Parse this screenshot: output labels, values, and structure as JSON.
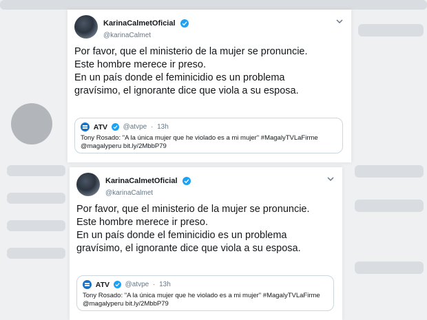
{
  "tweets": [
    {
      "display_name": "KarinaCalmetOficial",
      "handle": "@karinaCalmet",
      "text_lines": [
        "Por favor, que el ministerio de la mujer se pronuncie.",
        "Este hombre merece ir preso.",
        "En un país donde el feminicidio es un problema",
        "gravísimo, el ignorante dice que viola a su esposa."
      ],
      "quote": {
        "name": "ATV",
        "handle": "@atvpe",
        "separator": "·",
        "time": "13h",
        "text_line1": "Tony Rosado: \"A la única mujer que he violado es a mi mujer\" #MagalyTVLaFirme",
        "text_line2": "@magalyperu  bit.ly/2MbbP79"
      }
    },
    {
      "display_name": "KarinaCalmetOficial",
      "handle": "@karinaCalmet",
      "text_lines": [
        "Por favor, que el ministerio de la mujer se pronuncie.",
        "Este hombre merece ir preso.",
        "En un país donde el feminicidio es un problema",
        "gravísimo, el ignorante dice que viola a su esposa."
      ],
      "quote": {
        "name": "ATV",
        "handle": "@atvpe",
        "separator": "·",
        "time": "13h",
        "text_line1": "Tony Rosado: \"A la única mujer que he violado es a mi mujer\" #MagalyTVLaFirme",
        "text_line2": "@magalyperu  bit.ly/2MbbP79"
      }
    }
  ],
  "icons": {
    "verified": "verified-badge-icon",
    "caret": "chevron-down-icon",
    "quote_logo": "atv-logo-icon"
  },
  "colors": {
    "verified_blue": "#1da1f2",
    "secondary_text": "#657786",
    "border": "#ccd6dd"
  }
}
